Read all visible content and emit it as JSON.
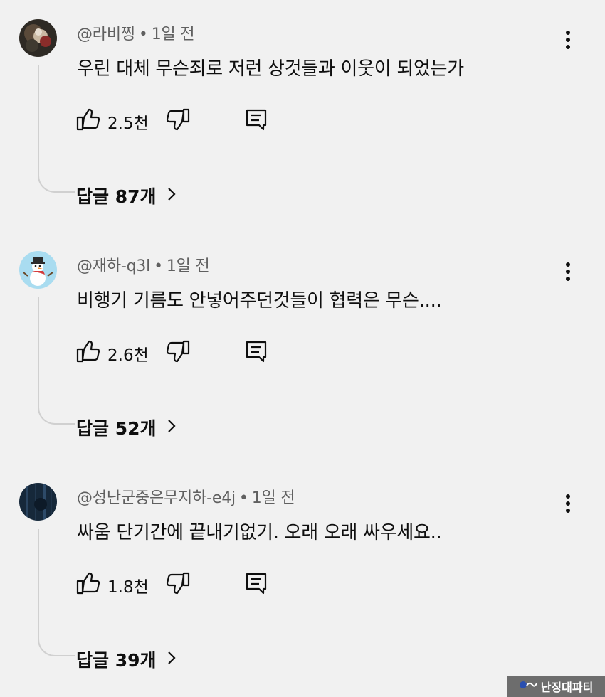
{
  "comments": [
    {
      "author": "@라비찡",
      "time": "1일 전",
      "text": "우린 대체 무슨죄로 저런 상것들과 이웃이 되었는가",
      "likes": "2.5천",
      "replies_label": "답글 87개",
      "avatar_icon": "dark-photo-avatar"
    },
    {
      "author": "@재하-q3l",
      "time": "1일 전",
      "text": "비행기 기름도 안넣어주던것들이 협력은 무슨....",
      "likes": "2.6천",
      "replies_label": "답글 52개",
      "avatar_icon": "snowman-avatar"
    },
    {
      "author": "@성난군중은무지하-e4j",
      "time": "1일 전",
      "text": "싸움 단기간에 끝내기없기. 오래 오래 싸우세요..",
      "likes": "1.8천",
      "replies_label": "답글 39개",
      "avatar_icon": "dark-blue-avatar"
    }
  ],
  "icons": {
    "like": "thumbs-up-icon",
    "dislike": "thumbs-down-icon",
    "reply": "comment-icon",
    "more": "more-vert-icon",
    "expand": "chevron-right-icon"
  },
  "colors": {
    "background": "#f1f1f1",
    "text": "#0f0f0f",
    "meta": "#606060",
    "thread_line": "#d0d0d0",
    "watermark_bg": "#6d6d6d"
  },
  "watermark": {
    "text": "난징대파티"
  }
}
